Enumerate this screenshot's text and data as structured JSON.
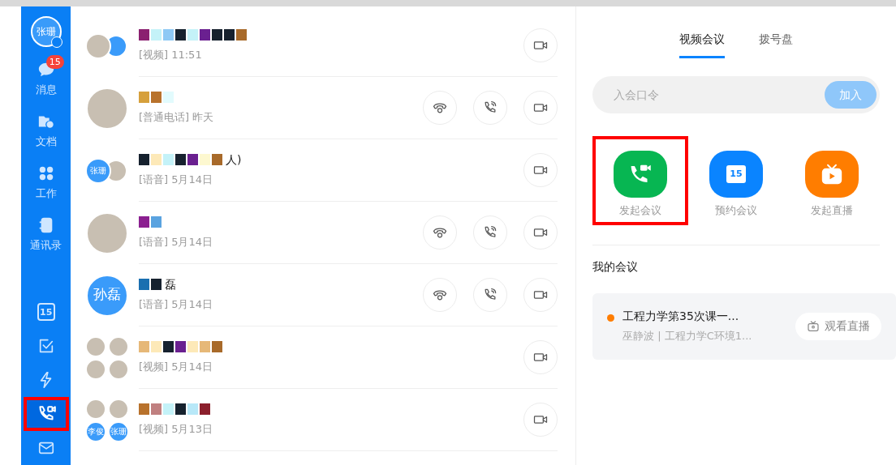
{
  "sidebar": {
    "user": {
      "label": "张珊"
    },
    "items": [
      {
        "kind": "chat",
        "label": "消息",
        "badge": "15",
        "selected": false,
        "highlighted": false
      },
      {
        "kind": "folder",
        "label": "文档",
        "selected": false,
        "highlighted": false
      },
      {
        "kind": "grid",
        "label": "工作",
        "selected": false,
        "highlighted": false
      },
      {
        "kind": "contacts",
        "label": "通讯录",
        "selected": false,
        "highlighted": false
      }
    ],
    "bottom_items": [
      {
        "kind": "calendar",
        "label": "15",
        "selected": false,
        "highlighted": false
      },
      {
        "kind": "check",
        "selected": false,
        "highlighted": false
      },
      {
        "kind": "bolt",
        "selected": false,
        "highlighted": false
      },
      {
        "kind": "call",
        "selected": true,
        "highlighted": true
      },
      {
        "kind": "mail",
        "selected": false,
        "highlighted": false
      }
    ]
  },
  "calls": [
    {
      "avatars": [
        {
          "kind": "photo"
        },
        {
          "kind": "blank"
        }
      ],
      "subtitle": "[视频] 11:51",
      "actions": [
        {
          "kind": "video"
        }
      ]
    },
    {
      "avatars": [
        {
          "kind": "photo"
        }
      ],
      "subtitle": "[普通电话] 昨天",
      "actions": [
        {
          "kind": "voice"
        },
        {
          "kind": "phone"
        },
        {
          "kind": "video"
        }
      ]
    },
    {
      "avatars": [
        {
          "kind": "text",
          "label": "张珊"
        },
        {
          "kind": "photo"
        }
      ],
      "name_suffix": "人)",
      "subtitle": "[语音] 5月14日",
      "actions": [
        {
          "kind": "video"
        }
      ]
    },
    {
      "avatars": [
        {
          "kind": "photo"
        }
      ],
      "subtitle": "[语音] 5月14日",
      "actions": [
        {
          "kind": "voice"
        },
        {
          "kind": "phone"
        },
        {
          "kind": "video"
        }
      ]
    },
    {
      "avatars": [
        {
          "kind": "text",
          "label": "孙磊"
        }
      ],
      "name_suffix": "磊",
      "subtitle": "[语音] 5月14日",
      "actions": [
        {
          "kind": "voice"
        },
        {
          "kind": "phone"
        },
        {
          "kind": "video"
        }
      ]
    },
    {
      "avatars": [
        {
          "kind": "photo"
        },
        {
          "kind": "photo"
        },
        {
          "kind": "photo"
        },
        {
          "kind": "photo"
        }
      ],
      "subtitle": "[视频] 5月14日",
      "actions": [
        {
          "kind": "video"
        }
      ]
    },
    {
      "avatars": [
        {
          "kind": "photo"
        },
        {
          "kind": "photo"
        },
        {
          "kind": "text",
          "label": "李俊"
        },
        {
          "kind": "text",
          "label": "张珊"
        }
      ],
      "subtitle": "[视频] 5月13日",
      "actions": [
        {
          "kind": "video"
        }
      ]
    }
  ],
  "meeting_panel": {
    "tabs": [
      {
        "label": "视频会议",
        "selected": true
      },
      {
        "label": "拨号盘",
        "selected": false
      }
    ],
    "join": {
      "placeholder": "入会口令",
      "button": "加入"
    },
    "actions": [
      {
        "kind": "start",
        "label": "发起会议",
        "color": "#07b652",
        "highlighted": true
      },
      {
        "kind": "schedule",
        "label": "预约会议",
        "color": "#0a84ff",
        "icon_text": "15",
        "highlighted": false
      },
      {
        "kind": "live",
        "label": "发起直播",
        "color": "#ff7d00",
        "highlighted": false
      }
    ],
    "my_meetings": {
      "title": "我的会议",
      "items": [
        {
          "title": "工程力学第35次课一...",
          "subtitle": "巫静波 | 工程力学C环境1...",
          "color": "#ff7d00",
          "button": "观看直播"
        }
      ]
    }
  }
}
